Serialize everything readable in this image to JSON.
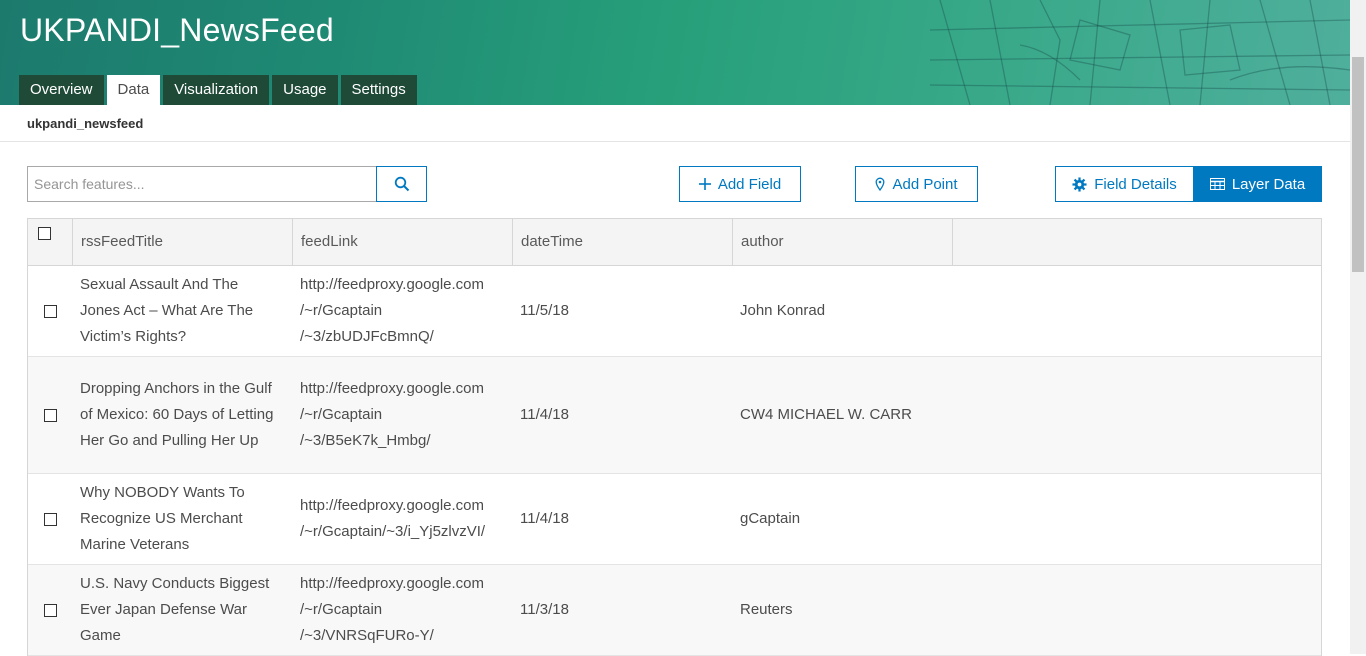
{
  "header": {
    "title": "UKPANDI_NewsFeed",
    "tabs": [
      {
        "label": "Overview",
        "active": false
      },
      {
        "label": "Data",
        "active": true
      },
      {
        "label": "Visualization",
        "active": false
      },
      {
        "label": "Usage",
        "active": false
      },
      {
        "label": "Settings",
        "active": false
      }
    ]
  },
  "layer_name": "ukpandi_newsfeed",
  "toolbar": {
    "search_placeholder": "Search features...",
    "add_field_label": "Add Field",
    "add_point_label": "Add Point",
    "field_details_label": "Field Details",
    "layer_data_label": "Layer Data"
  },
  "table": {
    "columns": [
      "rssFeedTitle",
      "feedLink",
      "dateTime",
      "author"
    ],
    "rows": [
      {
        "title": "Sexual Assault And The Jones Act – What Are The Victim’s Rights?",
        "link_lines": [
          "http://feedproxy.google.com",
          "/~r/Gcaptain",
          "/~3/zbUDJFcBmnQ/"
        ],
        "date": "11/5/18",
        "author": "John Konrad"
      },
      {
        "title": "Dropping Anchors in the Gulf of Mexico: 60 Days of Letting Her Go and Pulling Her Up",
        "link_lines": [
          "http://feedproxy.google.com",
          "/~r/Gcaptain",
          "/~3/B5eK7k_Hmbg/"
        ],
        "date": "11/4/18",
        "author": "CW4 MICHAEL W. CARR"
      },
      {
        "title": "Why NOBODY Wants To Recognize US Merchant Marine Veterans",
        "link_lines": [
          "http://feedproxy.google.com",
          "/~r/Gcaptain/~3/i_Yj5zlvzVI/"
        ],
        "date": "11/4/18",
        "author": "gCaptain"
      },
      {
        "title": "U.S. Navy Conducts Biggest Ever Japan Defense War Game",
        "link_lines": [
          "http://feedproxy.google.com",
          "/~r/Gcaptain",
          "/~3/VNRSqFURo-Y/"
        ],
        "date": "11/3/18",
        "author": "Reuters"
      }
    ]
  },
  "colors": {
    "accent": "#0079c1",
    "tab_bg": "#1e4a37",
    "banner_start": "#1c7a6d",
    "banner_end": "#4faf9c"
  }
}
